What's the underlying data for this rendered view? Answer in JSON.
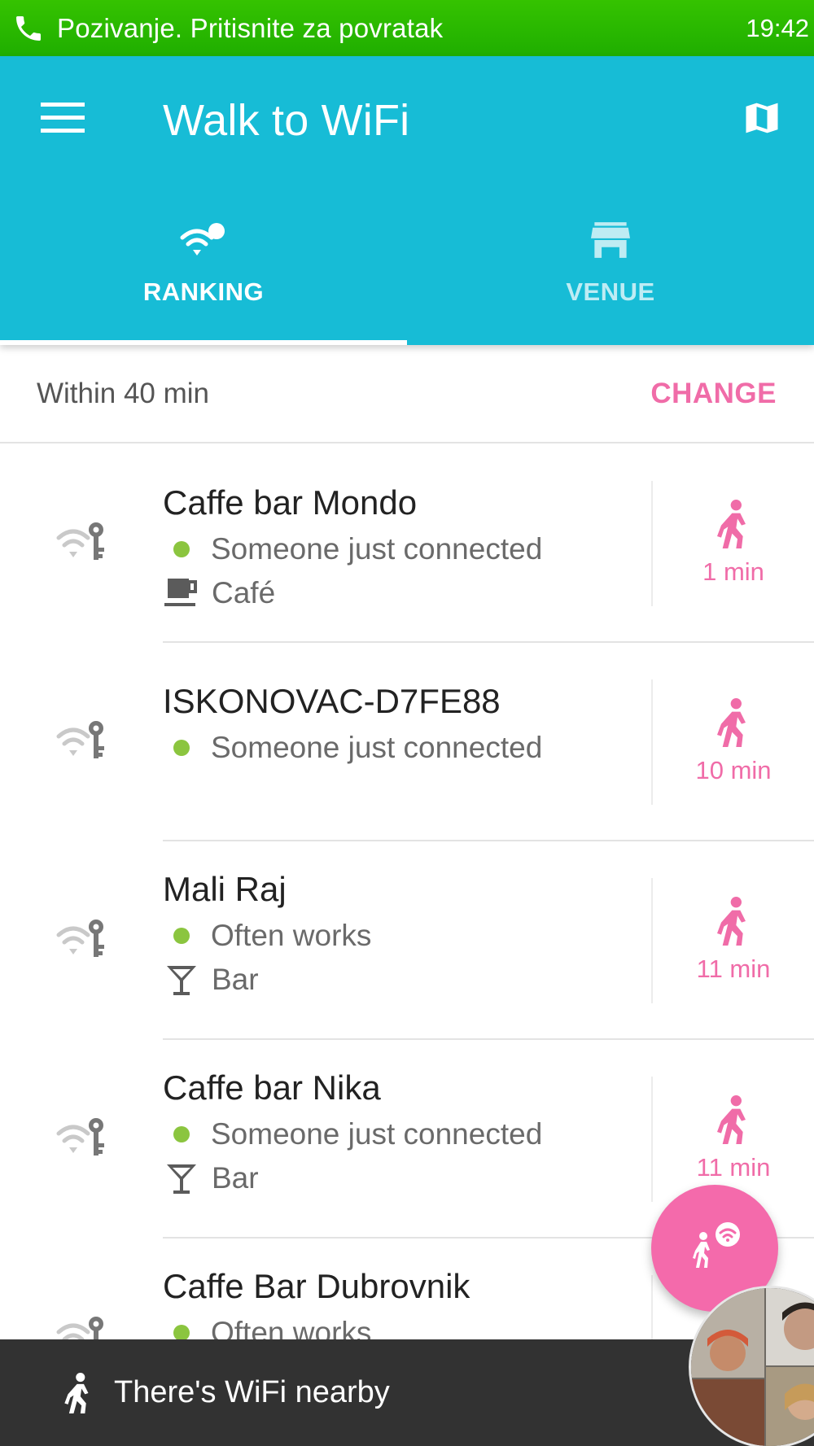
{
  "status_bar": {
    "call_text": "Pozivanje. Pritisnite za povratak",
    "time": "19:42",
    "icon": "phone-icon",
    "color": "#2bb800"
  },
  "app_bar": {
    "title": "Walk to WiFi",
    "menu_icon": "menu-icon",
    "map_icon": "map-icon",
    "color": "#17bcd6"
  },
  "tabs": [
    {
      "label": "RANKING",
      "icon": "wifi-ranking-icon",
      "selected": true
    },
    {
      "label": "VENUE",
      "icon": "store-icon",
      "selected": false
    }
  ],
  "filter": {
    "label": "Within 40 min",
    "action": "CHANGE"
  },
  "accent_color": "#f06ca8",
  "status_dot_color": "#8bc53f",
  "hotspots": [
    {
      "name": "Caffe bar Mondo",
      "status": "Someone just connected",
      "category": "Café",
      "category_icon": "coffee-cup-icon",
      "walk_time": "1 min"
    },
    {
      "name": "ISKONOVAC-D7FE88",
      "status": "Someone just connected",
      "category": "",
      "category_icon": "",
      "walk_time": "10 min"
    },
    {
      "name": "Mali Raj",
      "status": "Often works",
      "category": "Bar",
      "category_icon": "cocktail-icon",
      "walk_time": "11 min"
    },
    {
      "name": "Caffe bar Nika",
      "status": "Someone just connected",
      "category": "Bar",
      "category_icon": "cocktail-icon",
      "walk_time": "11 min"
    },
    {
      "name": "Caffe Bar Dubrovnik",
      "status": "Often works",
      "category": "",
      "category_icon": "",
      "walk_time": ""
    }
  ],
  "fab": {
    "icon": "walk-to-wifi-icon"
  },
  "snackbar": {
    "text": "There's WiFi nearby",
    "icon": "walking-person-icon"
  },
  "video_bubble": {
    "icon": "video-call-bubble"
  }
}
